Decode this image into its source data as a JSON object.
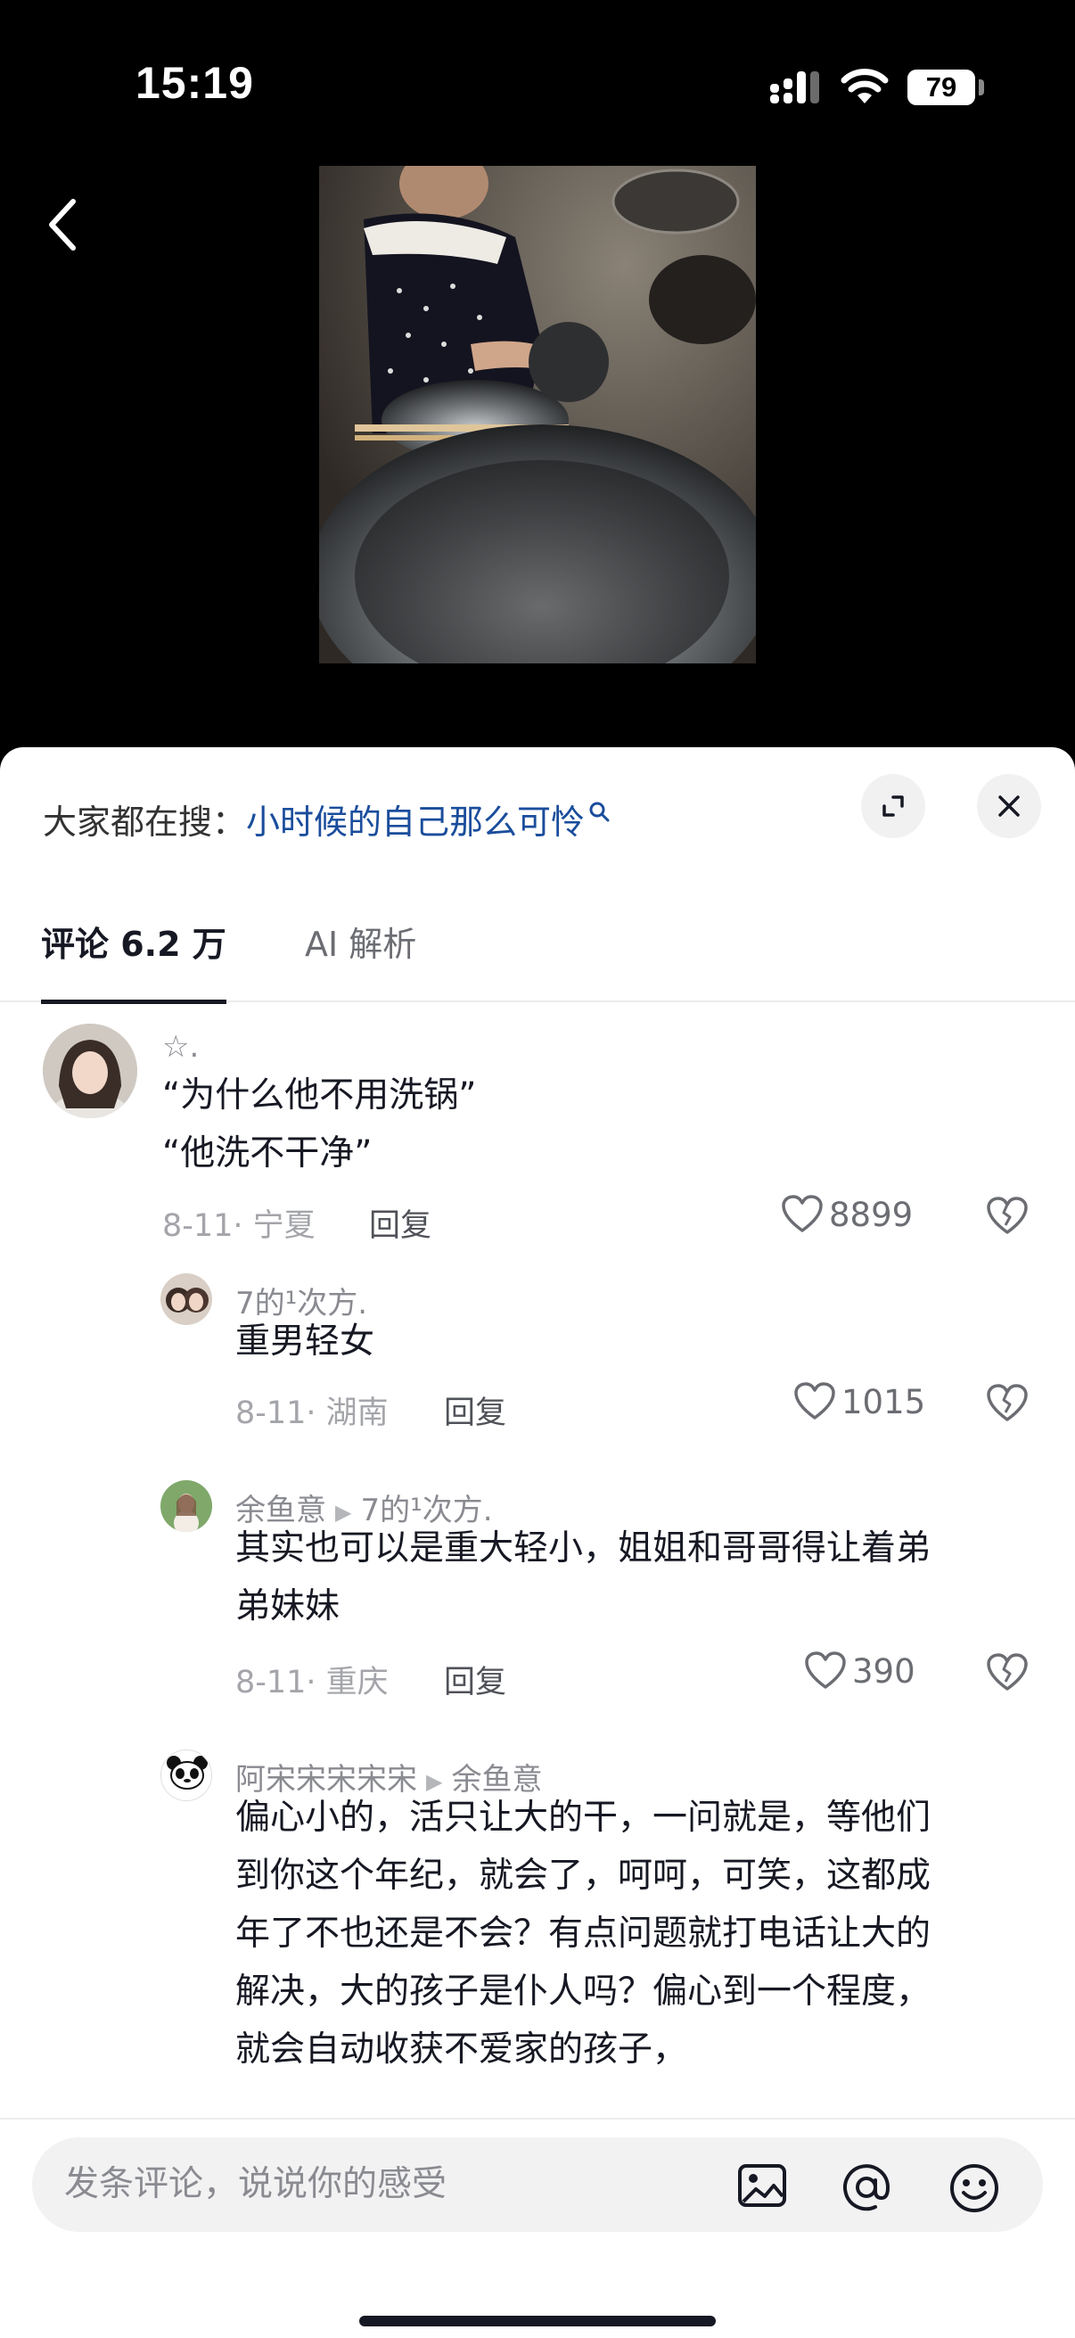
{
  "status": {
    "time": "15:19",
    "battery": "79"
  },
  "search": {
    "prefix": "大家都在搜：",
    "term": "小时候的自己那么可怜"
  },
  "tabs": [
    {
      "label": "评论 6.2 万"
    },
    {
      "label": "AI 解析"
    }
  ],
  "comments": [
    {
      "user": "☆.",
      "lines": [
        "“为什么他不用洗锅”",
        "“他洗不干净”"
      ],
      "meta": "8-11· 宁夏",
      "reply": "回复",
      "likes": "8899"
    },
    {
      "user": "7的¹次方.",
      "lines": [
        "重男轻女"
      ],
      "meta": "8-11· 湖南",
      "reply": "回复",
      "likes": "1015"
    },
    {
      "user": "余鱼意",
      "reply_to": "7的¹次方.",
      "lines": [
        "其实也可以是重大轻小，姐姐和哥哥得让着弟",
        "弟妹妹"
      ],
      "meta": "8-11· 重庆",
      "reply": "回复",
      "likes": "390"
    },
    {
      "user": "阿宋宋宋宋宋",
      "reply_to": "余鱼意",
      "lines": [
        "偏心小的，活只让大的干，一问就是，等他们",
        "到你这个年纪，就会了，呵呵，可笑，这都成",
        "年了不也还是不会？有点问题就打电话让大的",
        "解决，大的孩子是仆人吗？偏心到一个程度，",
        "就会自动收获不爱家的孩子，"
      ]
    }
  ],
  "input": {
    "placeholder": "发条评论，说说你的感受"
  },
  "colors": {
    "panel_bg": "#ffffff",
    "link_blue": "#1a4d9c",
    "text_dark": "#161823",
    "text_gray": "#8a8b91"
  }
}
